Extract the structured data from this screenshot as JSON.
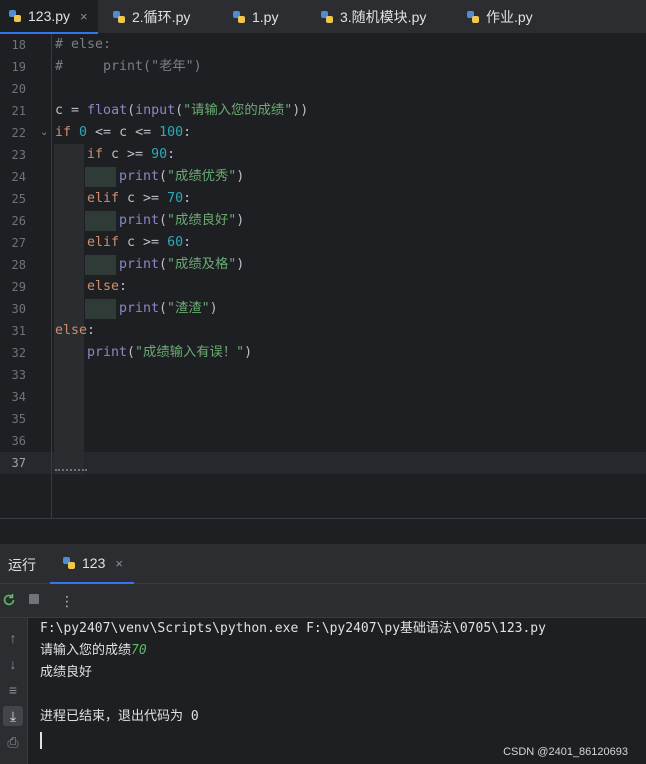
{
  "tabs": [
    {
      "label": "123.py",
      "active": true,
      "close": "×"
    },
    {
      "label": "2.循环.py"
    },
    {
      "label": "1.py"
    },
    {
      "label": "3.随机模块.py"
    },
    {
      "label": "作业.py"
    }
  ],
  "editor": {
    "line_numbers": [
      "18",
      "19",
      "20",
      "21",
      "22",
      "23",
      "24",
      "25",
      "26",
      "27",
      "28",
      "29",
      "30",
      "31",
      "32",
      "33",
      "34",
      "35",
      "36",
      "37"
    ],
    "current_line": "37",
    "lines": {
      "l18": {
        "comment": "# else:"
      },
      "l19": {
        "comment": "#     print(\"老年\")"
      },
      "l21": {
        "var": "c",
        "op": " = ",
        "fn1": "float",
        "p1": "(",
        "fn2": "input",
        "p2": "(",
        "str": "\"请输入您的成绩\"",
        "p3": "))"
      },
      "l22": {
        "kw": "if",
        "sp": " ",
        "n1": "0",
        "mid": " <= c <= ",
        "n2": "100",
        "colon": ":"
      },
      "l23": {
        "kw": "if",
        "mid": " c >= ",
        "num": "90",
        "colon": ":"
      },
      "l24": {
        "fn": "print",
        "open": "(",
        "str": "\"成绩优秀\"",
        "close": ")"
      },
      "l25": {
        "kw": "elif",
        "mid": " c >= ",
        "num": "70",
        "colon": ":"
      },
      "l26": {
        "fn": "print",
        "open": "(",
        "str": "\"成绩良好\"",
        "close": ")"
      },
      "l27": {
        "kw": "elif",
        "mid": " c >= ",
        "num": "60",
        "colon": ":"
      },
      "l28": {
        "fn": "print",
        "open": "(",
        "str": "\"成绩及格\"",
        "close": ")"
      },
      "l29": {
        "kw": "else",
        "colon": ":"
      },
      "l30": {
        "fn": "print",
        "open": "(",
        "str": "\"渣渣\"",
        "close": ")"
      },
      "l31": {
        "kw": "else",
        "colon": ":"
      },
      "l32": {
        "fn": "print",
        "open": "(",
        "str": "\"成绩输入有误！\"",
        "close": ")"
      }
    }
  },
  "run_panel": {
    "label": "运行",
    "tab_label": "123",
    "tab_close": "×"
  },
  "console": {
    "command": "F:\\py2407\\venv\\Scripts\\python.exe F:\\py2407\\py基础语法\\0705\\123.py",
    "prompt": "请输入您的成绩",
    "input_value": "70",
    "output": "成绩良好",
    "exit_message": "进程已结束，退出代码为 0"
  },
  "watermark": "CSDN @2401_86120693",
  "colors": {
    "accent": "#3574f0",
    "keyword": "#cf8e6d",
    "string": "#6aab73",
    "number": "#2aacb8",
    "builtin": "#8888c6"
  }
}
